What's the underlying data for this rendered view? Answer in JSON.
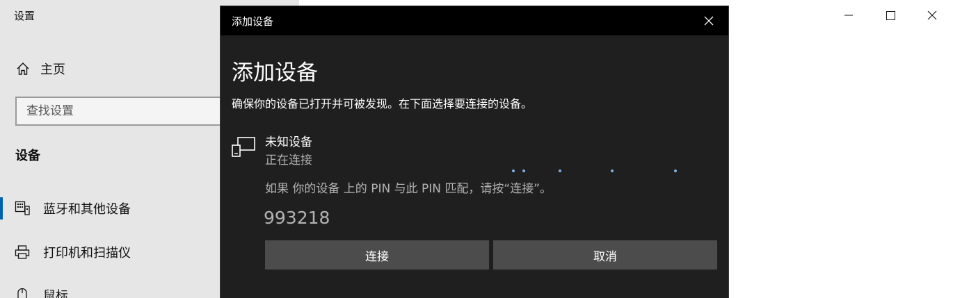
{
  "settings": {
    "title": "设置",
    "home_label": "主页",
    "search_placeholder": "查找设置",
    "section_heading": "设备",
    "nav_items": [
      {
        "label": "蓝牙和其他设备",
        "icon": "bluetooth-devices-icon",
        "selected": true
      },
      {
        "label": "打印机和扫描仪",
        "icon": "printer-icon",
        "selected": false
      },
      {
        "label": "鼠标",
        "icon": "mouse-icon",
        "selected": false
      }
    ]
  },
  "dialog": {
    "window_title": "添加设备",
    "heading": "添加设备",
    "description": "确保你的设备已打开并可被发现。在下面选择要连接的设备。",
    "device": {
      "name": "未知设备",
      "status": "正在连接",
      "pin_message": "如果 你的设备 上的 PIN 与此 PIN 匹配，请按“连接”。",
      "pin_code": "993218"
    },
    "connect_label": "连接",
    "cancel_label": "取消"
  },
  "colors": {
    "dialog_bg": "#1f1f1f",
    "titlebar_bg": "#000000",
    "button_bg": "#4c4c4c",
    "accent": "#0063b1",
    "progress_dots": "#7fb0e6"
  }
}
